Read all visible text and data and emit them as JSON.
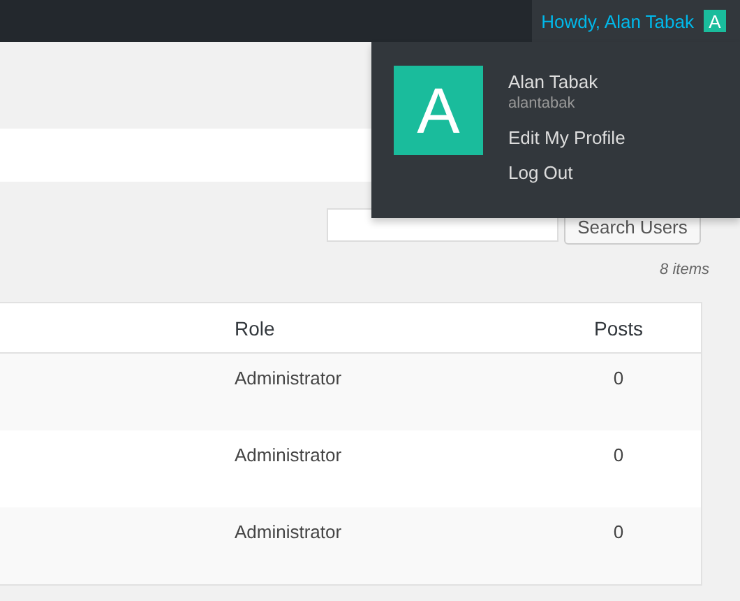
{
  "admin_bar": {
    "greeting": "Howdy, Alan Tabak",
    "avatar_letter": "A"
  },
  "user_menu": {
    "avatar_letter": "A",
    "display_name": "Alan Tabak",
    "username": "alantabak",
    "links": [
      "Edit My Profile",
      "Log Out"
    ]
  },
  "search": {
    "button": "Search Users"
  },
  "item_count": "8 items",
  "table": {
    "columns": [
      "Role",
      "Posts"
    ],
    "rows": [
      {
        "role": "Administrator",
        "posts": "0"
      },
      {
        "role": "Administrator",
        "posts": "0"
      },
      {
        "role": "Administrator",
        "posts": "0"
      }
    ]
  }
}
